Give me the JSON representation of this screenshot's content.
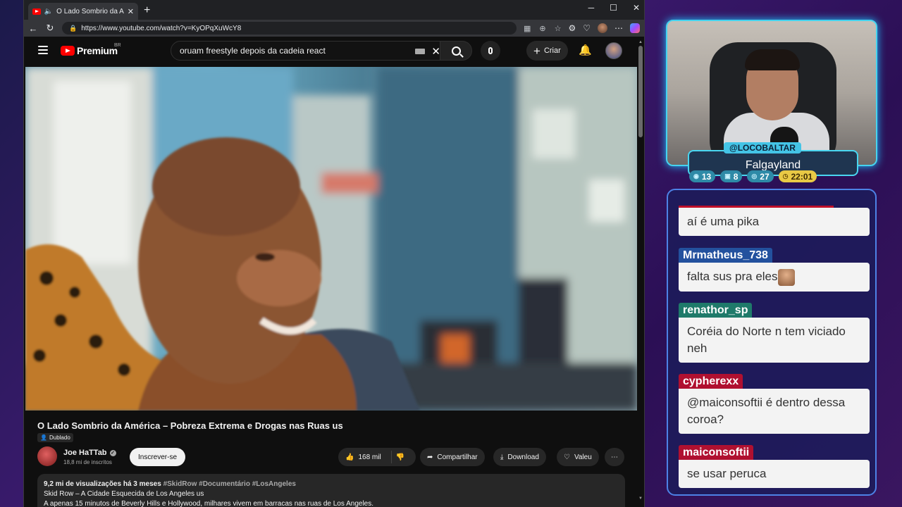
{
  "browser": {
    "tab_title": "O Lado Sombrio da América",
    "url": "https://www.youtube.com/watch?v=KyOPqXuWcY8"
  },
  "youtube": {
    "brand": "Premium",
    "region": "BR",
    "search_query": "oruam freestyle depois da cadeia react",
    "create_label": "Criar",
    "video": {
      "title": "O Lado Sombrio da América – Pobreza Extrema e Drogas nas Ruas us",
      "dub_label": "Dublado",
      "channel_name": "Joe HaTTab",
      "subscribers": "18,8 mi de inscritos",
      "subscribe_label": "Inscrever-se",
      "likes": "168 mil",
      "share_label": "Compartilhar",
      "download_label": "Download",
      "thanks_label": "Valeu",
      "views": "9,2 mi de visualizações",
      "age": "há 3 meses",
      "hashtags": "#SkidRow #Documentário #LosAngeles",
      "desc_line1": "Skid Row – A Cidade Esquecida de Los Angeles us",
      "desc_line2": "A apenas 15 minutos de Beverly Hills e Hollywood, milhares vivem em barracas nas ruas de Los Angeles."
    }
  },
  "overlay": {
    "handle": "@LOCOBALTAR",
    "game": "Falgayland",
    "stats": [
      {
        "icon": "twitch-icon",
        "value": "13"
      },
      {
        "icon": "chat-icon",
        "value": "8"
      },
      {
        "icon": "viewers-icon",
        "value": "27"
      },
      {
        "icon": "clock-icon",
        "value": "22:01"
      }
    ]
  },
  "chat": {
    "messages": [
      {
        "user": "",
        "user_color": "#c0102a",
        "text": "aí é uma pika"
      },
      {
        "user": "Mrmatheus_738",
        "user_color": "#23519e",
        "text": "falta sus pra eles"
      },
      {
        "user": "renathor_sp",
        "user_color": "#1f7a6a",
        "text": "Coréia do Norte n tem viciado neh"
      },
      {
        "user": "cypherexx",
        "user_color": "#b01030",
        "text": "@maiconsoftii é dentro dessa coroa?"
      },
      {
        "user": "maiconsoftii",
        "user_color": "#b01030",
        "text": "se usar peruca"
      }
    ]
  }
}
